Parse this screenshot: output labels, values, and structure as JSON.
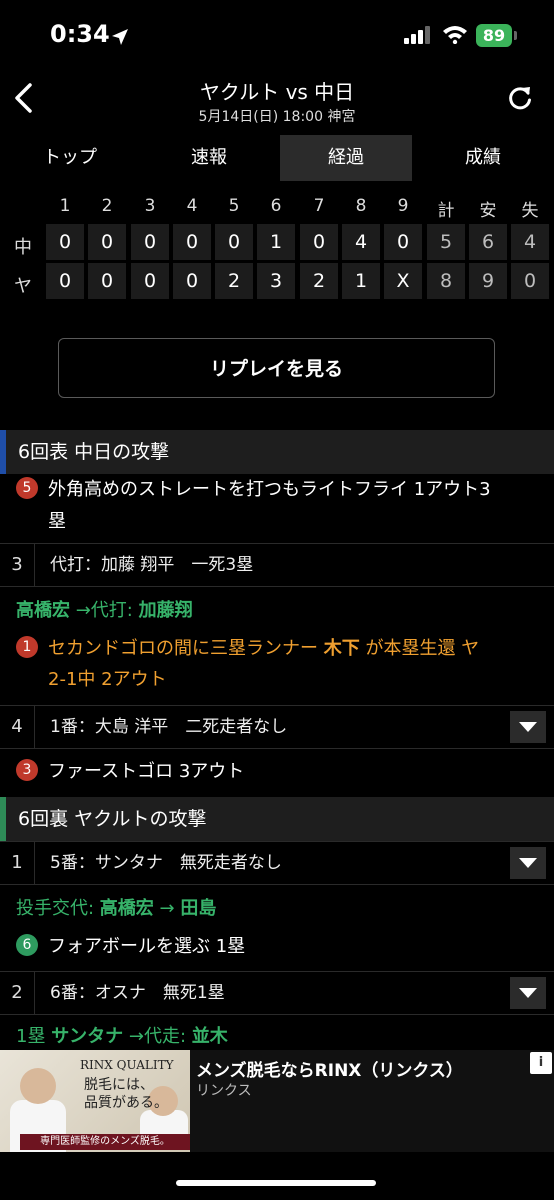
{
  "status": {
    "time": "0:34",
    "battery": "89"
  },
  "header": {
    "title": "ヤクルト vs 中日",
    "subtitle": "5月14日(日) 18:00 神宮"
  },
  "tabs": [
    "トップ",
    "速報",
    "経過",
    "成績"
  ],
  "active_tab": "経過",
  "scoreboard": {
    "headers": [
      "1",
      "2",
      "3",
      "4",
      "5",
      "6",
      "7",
      "8",
      "9",
      "計",
      "安",
      "失"
    ],
    "rows": [
      {
        "team": "中",
        "cells": [
          "0",
          "0",
          "0",
          "0",
          "0",
          "1",
          "0",
          "4",
          "0",
          "5",
          "6",
          "4"
        ]
      },
      {
        "team": "ヤ",
        "cells": [
          "0",
          "0",
          "0",
          "0",
          "2",
          "3",
          "2",
          "1",
          "X",
          "8",
          "9",
          "0"
        ]
      }
    ]
  },
  "replay_button": "リプレイを見る",
  "sections": {
    "s1": {
      "title": "6回表 中日の攻撃",
      "color": "#1f4ea8"
    },
    "s2": {
      "title": "6回裏 ヤクルトの攻撃",
      "color": "#2e8b57"
    }
  },
  "events": {
    "e1": {
      "badge": "5",
      "line1": "外角高めのストレートを打つもライトフライ 1アウト3",
      "line2": "塁",
      "badge_color": "#c0392b"
    },
    "r3": {
      "num": "3",
      "text": "代打：加藤 翔平　一死3塁"
    },
    "sub1": {
      "a": "高橋宏",
      "b": " →代打: ",
      "c": "加藤翔"
    },
    "e2": {
      "badge": "1",
      "line1a": "セカンドゴロの間に三塁ランナー ",
      "line1b": "木下",
      "line1c": " が本塁生還 ヤ",
      "line2": "2-1中 2アウト",
      "badge_color": "#c0392b"
    },
    "r4": {
      "num": "4",
      "text": "1番：大島 洋平　二死走者なし"
    },
    "e3": {
      "badge": "3",
      "text": "ファーストゴロ 3アウト",
      "badge_color": "#c0392b"
    },
    "r1": {
      "num": "1",
      "text": "5番：サンタナ　無死走者なし"
    },
    "sub2": {
      "a": "投手交代: ",
      "b": "高橋宏",
      "c": " → ",
      "d": "田島"
    },
    "e4": {
      "badge": "6",
      "text": "フォアボールを選ぶ 1塁",
      "badge_color": "#2e9b5f"
    },
    "r2": {
      "num": "2",
      "text": "6番：オスナ　無死1塁"
    },
    "sub3": {
      "a": "1塁 ",
      "b": "サンタナ",
      "c": " →代走: ",
      "d": "並木"
    }
  },
  "ad": {
    "title": "メンズ脱毛ならRINX（リンクス）",
    "sub": "リンクス",
    "brand": "RINX QUALITY",
    "copy1": "脱毛には、",
    "copy2": "品質がある。",
    "foot": "専門医師監修のメンズ脱毛。",
    "info": "i"
  }
}
